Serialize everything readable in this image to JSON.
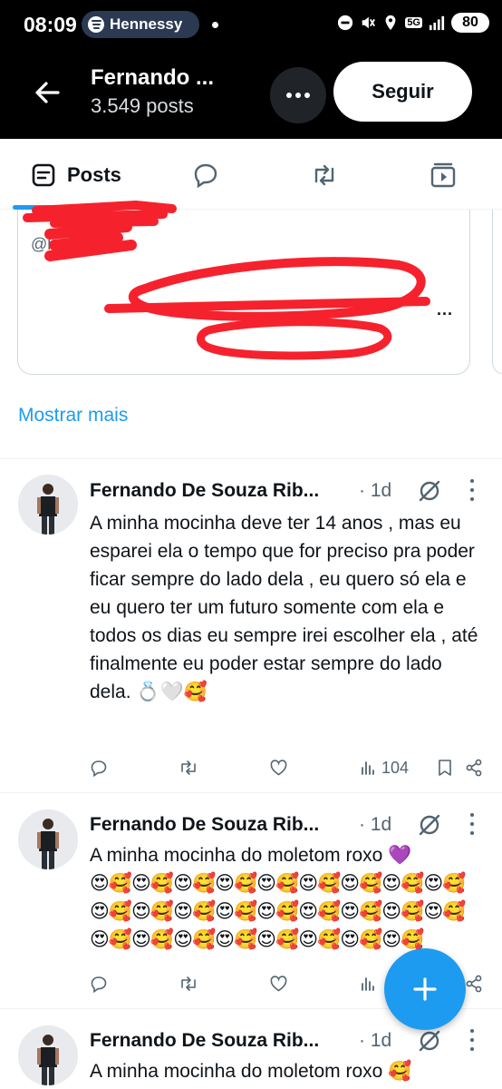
{
  "status_bar": {
    "time": "08:09",
    "media_app": "Hennessy",
    "network": "5G",
    "battery": "80"
  },
  "header": {
    "title": "Fernando ...",
    "posts_count": "3.549 posts",
    "follow_label": "Seguir"
  },
  "tabs": {
    "posts_label": "Posts"
  },
  "quoted_card": {
    "handle": "@l",
    "more": "..."
  },
  "show_more": "Mostrar mais",
  "tweets": [
    {
      "name": "Fernando De Souza Rib...",
      "time": "· 1d",
      "text": "A minha mocinha deve ter 14 anos , mas eu esparei ela o tempo que for preciso pra poder ficar sempre do lado dela , eu quero só ela e eu quero ter um futuro somente com ela e todos os dias eu sempre irei escolher ela , até finalmente eu poder estar sempre do lado dela. 💍🤍🥰",
      "views": "104"
    },
    {
      "name": "Fernando De Souza Rib...",
      "time": "· 1d",
      "text": "A minha mocinha do moletom roxo 💜",
      "emoji": "😍🥰😍🥰😍🥰😍🥰😍🥰😍🥰😍🥰😍🥰😍🥰😍🥰😍🥰😍🥰😍🥰😍🥰😍🥰😍🥰😍🥰😍🥰😍🥰😍🥰😍🥰😍🥰😍🥰😍🥰😍🥰😍🥰"
    },
    {
      "name": "Fernando De Souza Rib...",
      "time": "· 1d",
      "text": "A minha mocinha do moletom roxo 🥰"
    }
  ],
  "colors": {
    "accent": "#1d9bf0",
    "header_bg": "#000000",
    "redaction": "#f5222d"
  }
}
